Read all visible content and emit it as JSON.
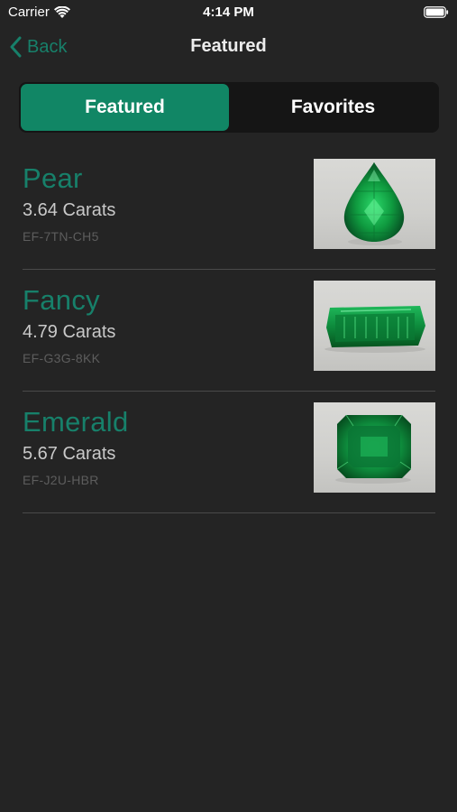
{
  "status": {
    "carrier": "Carrier",
    "time": "4:14 PM"
  },
  "nav": {
    "back_label": "Back",
    "title": "Featured"
  },
  "segments": [
    {
      "label": "Featured",
      "active": true
    },
    {
      "label": "Favorites",
      "active": false
    }
  ],
  "items": [
    {
      "name": "Pear",
      "carats": "3.64 Carats",
      "code": "EF-7TN-CH5",
      "image_icon": "pear-emerald-photo"
    },
    {
      "name": "Fancy",
      "carats": "4.79 Carats",
      "code": "EF-G3G-8KK",
      "image_icon": "fancy-emerald-photo"
    },
    {
      "name": "Emerald",
      "carats": "5.67 Carats",
      "code": "EF-J2U-HBR",
      "image_icon": "emerald-cut-photo"
    }
  ],
  "colors": {
    "background": "#242424",
    "accent": "#17806a",
    "segment_active": "#118665"
  }
}
